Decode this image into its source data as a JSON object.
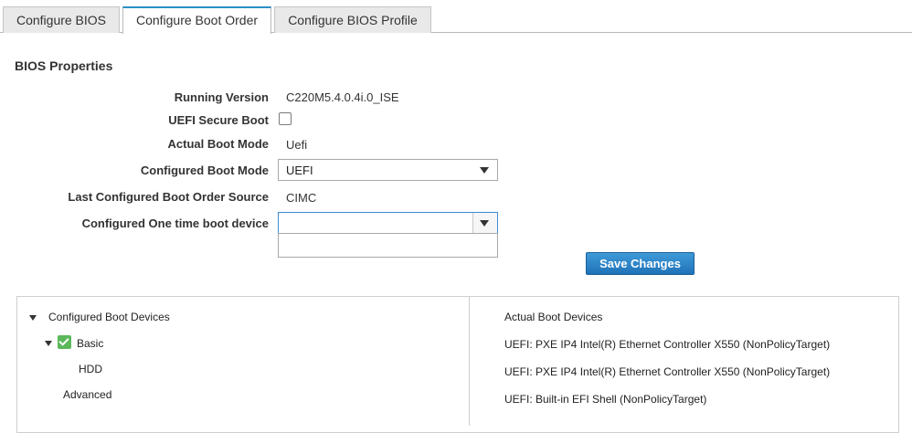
{
  "tabs": [
    {
      "label": "Configure BIOS",
      "active": false
    },
    {
      "label": "Configure Boot Order",
      "active": true
    },
    {
      "label": "Configure BIOS Profile",
      "active": false
    }
  ],
  "section_title": "BIOS Properties",
  "properties": {
    "running_version": {
      "label": "Running Version",
      "value": "C220M5.4.0.4i.0_ISE"
    },
    "uefi_secure_boot": {
      "label": "UEFI Secure Boot",
      "checked": false
    },
    "actual_boot_mode": {
      "label": "Actual Boot Mode",
      "value": "Uefi"
    },
    "configured_boot_mode": {
      "label": "Configured Boot Mode",
      "value": "UEFI"
    },
    "last_boot_order_source": {
      "label": "Last Configured Boot Order Source",
      "value": "CIMC"
    },
    "one_time_boot_device": {
      "label": "Configured One time boot device",
      "value": ""
    }
  },
  "save_button": "Save Changes",
  "configured_tree": {
    "root": "Configured Boot Devices",
    "basic": "Basic",
    "hdd": "HDD",
    "advanced": "Advanced"
  },
  "actual_devices": {
    "header": "Actual Boot Devices",
    "items": [
      "UEFI: PXE IP4 Intel(R) Ethernet Controller X550 (NonPolicyTarget)",
      "UEFI: PXE IP4 Intel(R) Ethernet Controller X550 (NonPolicyTarget)",
      "UEFI: Built-in EFI Shell (NonPolicyTarget)"
    ]
  },
  "colors": {
    "accent": "#2a8fc7",
    "button": "#1f72b8",
    "check": "#5bb85b"
  }
}
